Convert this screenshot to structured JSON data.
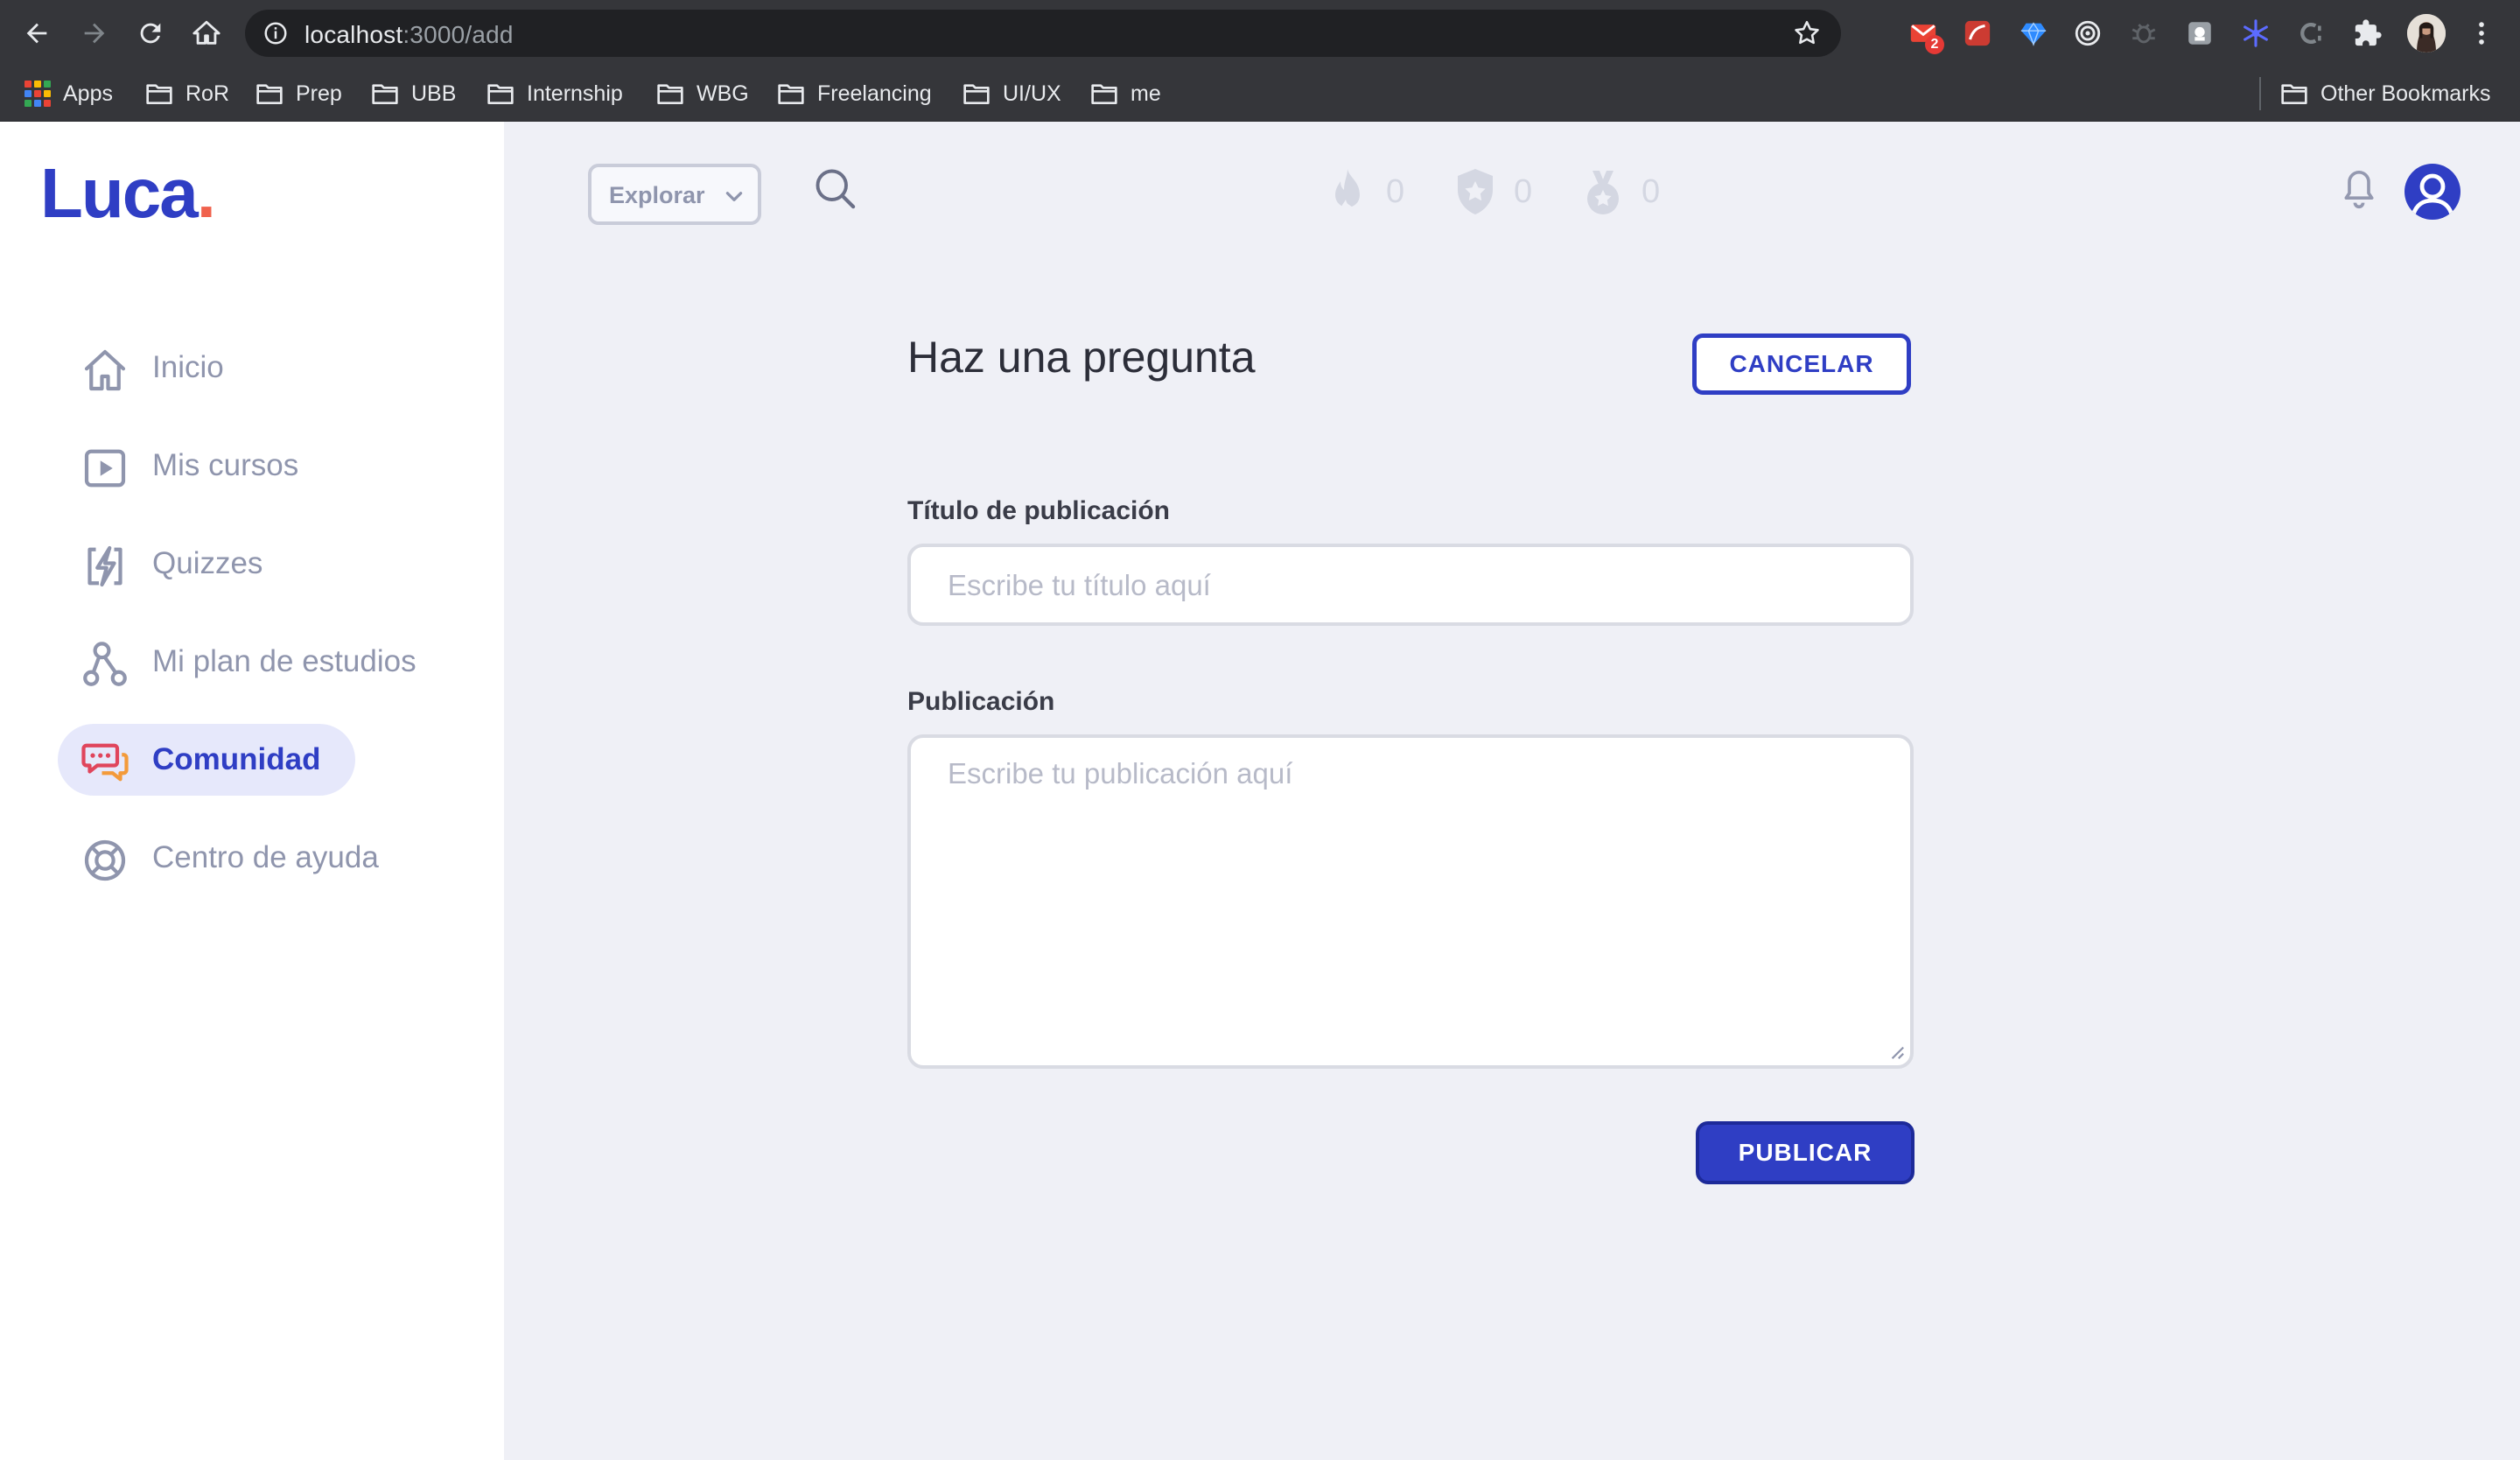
{
  "browser": {
    "url_host": "localhost",
    "url_path": ":3000/add",
    "gmail_badge": "2",
    "bookmarks": [
      {
        "label": "Apps",
        "icon": "apps-grid-icon"
      },
      {
        "label": "RoR",
        "icon": "folder-icon"
      },
      {
        "label": "Prep",
        "icon": "folder-icon"
      },
      {
        "label": "UBB",
        "icon": "folder-icon"
      },
      {
        "label": "Internship",
        "icon": "folder-icon"
      },
      {
        "label": "WBG",
        "icon": "folder-icon"
      },
      {
        "label": "Freelancing",
        "icon": "folder-icon"
      },
      {
        "label": "UI/UX",
        "icon": "folder-icon"
      },
      {
        "label": "me",
        "icon": "folder-icon"
      }
    ],
    "other_bookmarks": "Other Bookmarks"
  },
  "brand": {
    "name": "Luca",
    "dot": ".",
    "color": "#2f3ec4",
    "dot_color": "#f0624d"
  },
  "sidebar": {
    "items": [
      {
        "label": "Inicio",
        "icon": "home-icon",
        "active": false
      },
      {
        "label": "Mis cursos",
        "icon": "play-icon",
        "active": false
      },
      {
        "label": "Quizzes",
        "icon": "lightning-icon",
        "active": false
      },
      {
        "label": "Mi plan de estudios",
        "icon": "study-plan-icon",
        "active": false
      },
      {
        "label": "Comunidad",
        "icon": "chat-icon",
        "active": true
      },
      {
        "label": "Centro de ayuda",
        "icon": "lifebuoy-icon",
        "active": false
      }
    ]
  },
  "header": {
    "explore_label": "Explorar",
    "stats": [
      {
        "icon": "flame-icon",
        "value": "0"
      },
      {
        "icon": "shield-star-icon",
        "value": "0"
      },
      {
        "icon": "medal-icon",
        "value": "0"
      }
    ]
  },
  "form": {
    "title": "Haz una pregunta",
    "cancel_label": "CANCELAR",
    "title_label": "Título de publicación",
    "title_placeholder": "Escribe tu título aquí",
    "body_label": "Publicación",
    "body_placeholder": "Escribe tu publicación aquí",
    "publish_label": "PUBLICAR"
  }
}
